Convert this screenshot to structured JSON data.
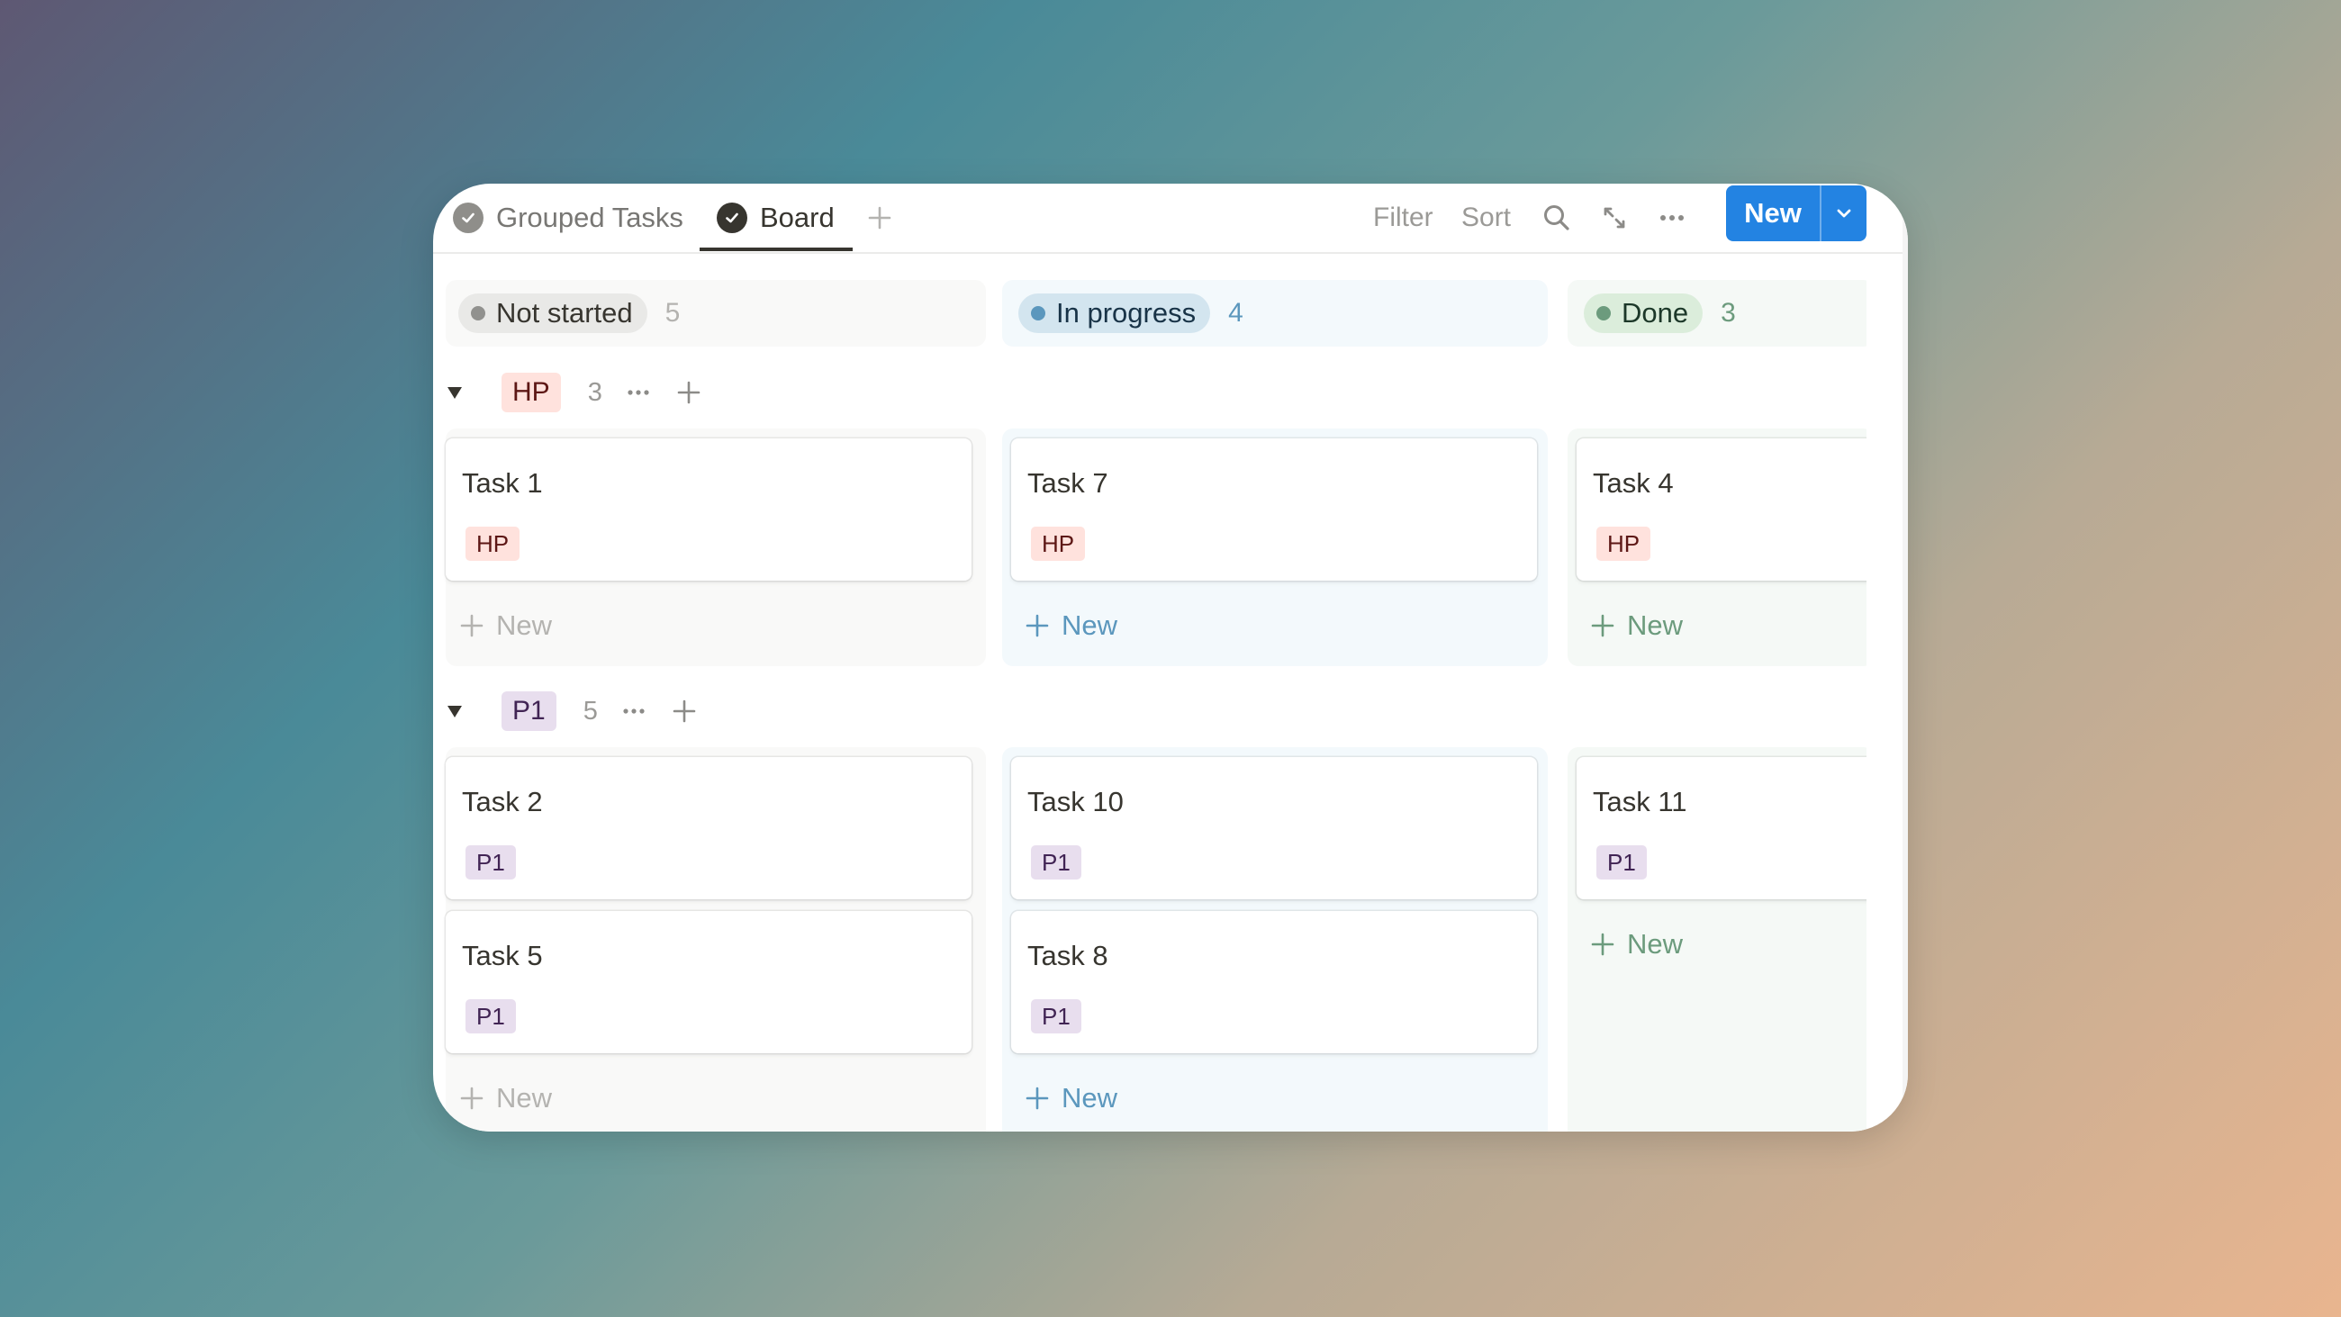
{
  "tabs": [
    {
      "label": "Grouped Tasks",
      "active": false
    },
    {
      "label": "Board",
      "active": true
    }
  ],
  "toolbar": {
    "filter_label": "Filter",
    "sort_label": "Sort",
    "new_label": "New"
  },
  "columns": [
    {
      "status": "Not started",
      "count": "5"
    },
    {
      "status": "In progress",
      "count": "4"
    },
    {
      "status": "Done",
      "count": "3"
    }
  ],
  "groups": [
    {
      "tag": "HP",
      "count": "3"
    },
    {
      "tag": "P1",
      "count": "5"
    }
  ],
  "cards": {
    "hp_not_started": [
      {
        "title": "Task 1",
        "tag": "HP"
      }
    ],
    "hp_in_progress": [
      {
        "title": "Task 7",
        "tag": "HP"
      }
    ],
    "hp_done": [
      {
        "title": "Task 4",
        "tag": "HP"
      }
    ],
    "p1_not_started": [
      {
        "title": "Task 2",
        "tag": "P1"
      },
      {
        "title": "Task 5",
        "tag": "P1"
      }
    ],
    "p1_in_progress": [
      {
        "title": "Task 10",
        "tag": "P1"
      },
      {
        "title": "Task 8",
        "tag": "P1"
      }
    ],
    "p1_done": [
      {
        "title": "Task 11",
        "tag": "P1"
      }
    ]
  },
  "add_label": "New",
  "colors": {
    "accent": "#2383e2",
    "hp_tag_bg": "#ffe2dd",
    "hp_tag_text": "#5d1715",
    "p1_tag_bg": "#e8deee",
    "p1_tag_text": "#412454",
    "not_started_bg": "#f9f9f8",
    "in_progress_bg": "#f3f9fc",
    "done_bg": "#f5f9f6"
  },
  "icons": [
    "check-icon",
    "plus-icon",
    "search-icon",
    "expand-icon",
    "more-icon",
    "chevron-down-icon",
    "caret-down-icon"
  ]
}
